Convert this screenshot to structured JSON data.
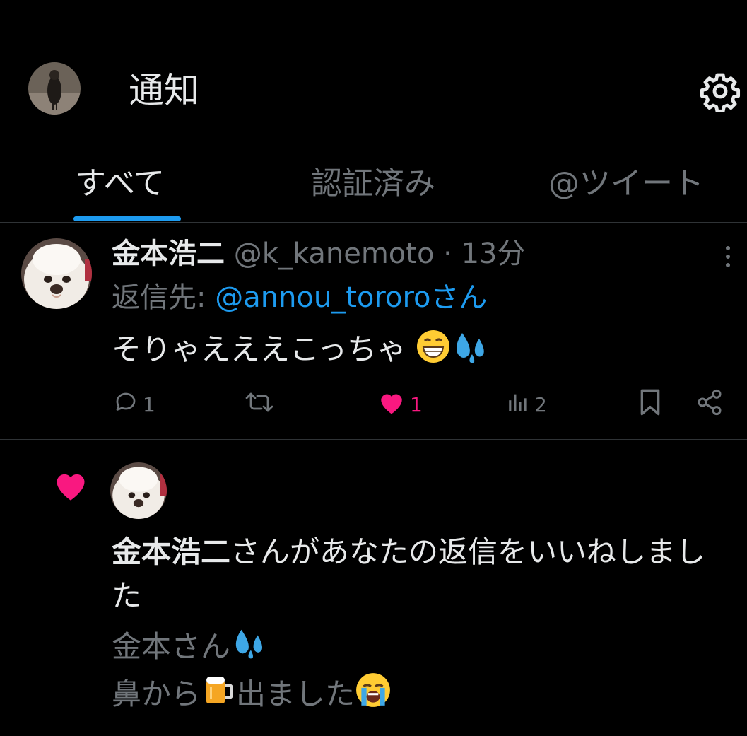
{
  "header": {
    "title": "通知",
    "avatar_icon": "user-avatar-bird",
    "settings_icon": "gear-icon"
  },
  "tabs": [
    {
      "label": "すべて",
      "active": true
    },
    {
      "label": "認証済み",
      "active": false
    },
    {
      "label": "@ツイート",
      "active": false
    }
  ],
  "tweet": {
    "author_name": "金本浩二",
    "handle": "@k_kanemoto",
    "separator": "·",
    "time": "13分",
    "reply_prefix": "返信先: ",
    "reply_to": "@annou_tororoさん",
    "text": "そりゃえええこっちゃ",
    "emojis": [
      "grinning-face",
      "sweat-droplets"
    ],
    "stats": {
      "replies": "1",
      "retweets": "",
      "likes": "1",
      "views": "2"
    }
  },
  "notification": {
    "actor_name": "金本浩二",
    "action_text": "さんがあなたの返信をいいねしました",
    "quote_line1": "金本さん",
    "quote_line2_a": "鼻から",
    "quote_line2_b": "出ました",
    "quote_emojis": [
      "sweat-droplets",
      "beer-mug",
      "crying-face"
    ]
  },
  "colors": {
    "background": "#000000",
    "text": "#e7e9ea",
    "muted": "#71767b",
    "accent": "#1d9bf0",
    "like": "#f91880",
    "divider": "#2f3336"
  }
}
